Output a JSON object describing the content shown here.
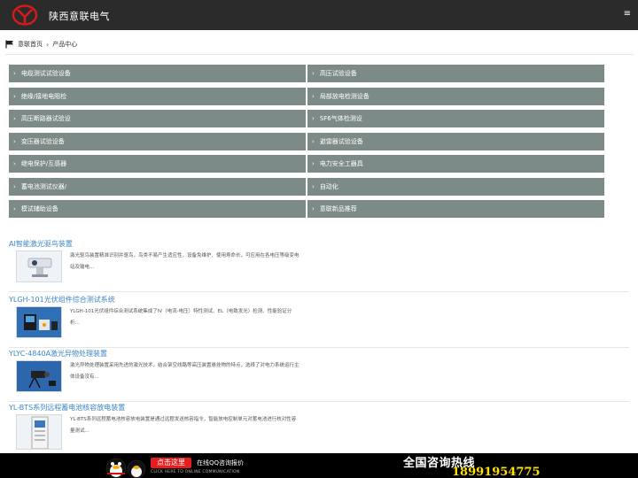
{
  "header": {
    "brand": "陕西意联电气",
    "menu_icon": "hamburger-icon"
  },
  "breadcrumb": {
    "home": "意联首页",
    "current": "产品中心",
    "separator": "›"
  },
  "categories": [
    "电缆测试试验设备",
    "高压试验设备",
    "绝缘/接地电阻检",
    "局部放电检测设备",
    "高压断路器试验设",
    "SF6气体检测设",
    "变压器试验设备",
    "避雷器试验设备",
    "继电保护/互感器",
    "电力安全工器具",
    "蓄电池测试仪器/",
    "自动化",
    "模试辅助设备",
    "意联新品推荐"
  ],
  "products": [
    {
      "title": "AI智能激光驱鸟装置",
      "desc": "激光驱鸟装置精准识别并驱鸟，鸟类不易产生适应性，设备免维护、使用寿命长，可应用在各电压等级变电站及输电...",
      "image_icon": "laser-bird-device-photo"
    },
    {
      "title": "YLGH-101光伏组件综合测试系统",
      "desc": "YLGH-101光伏组件综合测试系统集成了IV（电流-电压）特性测试、EL（电致发光）检测、性能验证分析...",
      "image_icon": "pv-tester-photo"
    },
    {
      "title": "YLYC-4840A激光异物处理装置",
      "desc": "激光异物处理装置采用先进的激光技术，结合架空线路等高压装置悬挂物的特点，选择了对电力系统运行主体设备没有...",
      "image_icon": "laser-removal-photo"
    },
    {
      "title": "YL-BTS系列远程蓄电池核容放电装置",
      "desc": "YL-BTS系列远程蓄电池核容放电装置是通过远程发送核容指令，智能放电控制单元对蓄电池进行核对性容量测试...",
      "image_icon": "battery-cabinet-photo"
    }
  ],
  "footer": {
    "click_label": "点击这里",
    "qq_text": "在线QQ咨询报价",
    "qq_sub": "CLICK HERE TO ONLINE COMMUNICATION",
    "hotline_label": "全国咨询热线",
    "hotline_number": "18991954775"
  },
  "colors": {
    "header_bg": "#2b2b2b",
    "category_bg": "#7d8b88",
    "link_blue": "#3b86c6",
    "hotline_yellow": "#ffe000",
    "button_red": "#e51e1e"
  }
}
